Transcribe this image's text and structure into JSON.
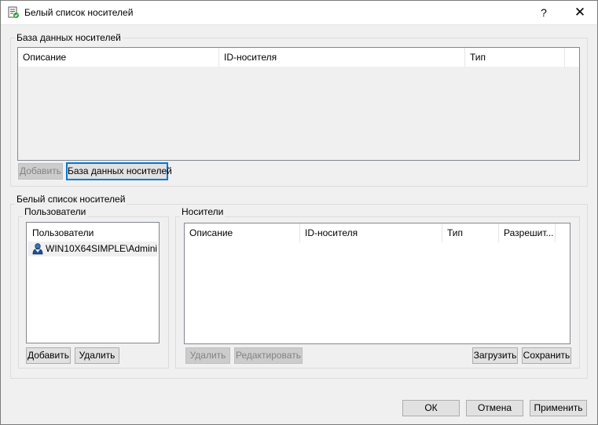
{
  "window": {
    "title": "Белый список носителей",
    "help_label": "?",
    "close_label": "✕"
  },
  "media_db": {
    "group_label": "База данных носителей",
    "columns": [
      "Описание",
      "ID-носителя",
      "Тип"
    ],
    "add_button": "Добавить",
    "db_button": "База данных носителей"
  },
  "whitelist": {
    "group_label": "Белый список носителей",
    "users": {
      "group_label": "Пользователи",
      "header": "Пользователи",
      "items": [
        "WIN10X64SIMPLE\\Admini..."
      ],
      "add_button": "Добавить",
      "delete_button": "Удалить"
    },
    "media": {
      "group_label": "Носители",
      "columns": [
        "Описание",
        "ID-носителя",
        "Тип",
        "Разрешит..."
      ],
      "delete_button": "Удалить",
      "edit_button": "Редактировать",
      "load_button": "Загрузить",
      "save_button": "Сохранить"
    }
  },
  "footer": {
    "ok_button": "ОК",
    "cancel_button": "Отмена",
    "apply_button": "Применить"
  },
  "icons": {
    "title": "whitelist-app-icon",
    "user": "user-icon"
  }
}
